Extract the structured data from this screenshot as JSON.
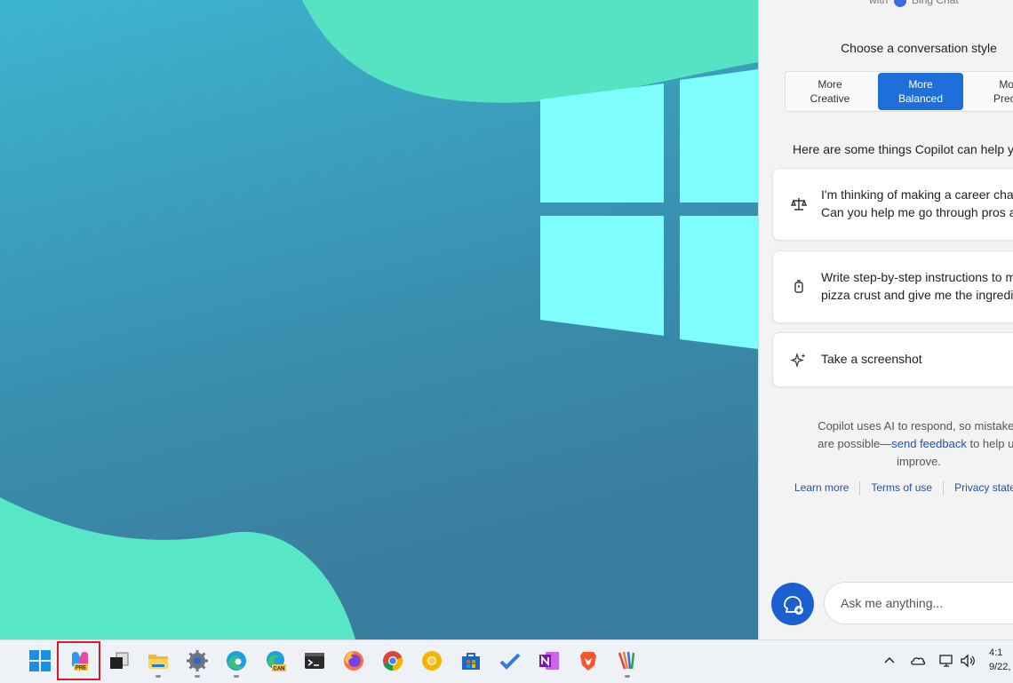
{
  "copilot": {
    "header_partial": "with  Bing Chat",
    "choose_style": "Choose a conversation style",
    "styles": [
      {
        "label": "More\nCreative",
        "active": false
      },
      {
        "label": "More\nBalanced",
        "active": true
      },
      {
        "label": "More\nPrecise",
        "active": false
      }
    ],
    "help_heading": "Here are some things Copilot can help you",
    "suggestions": [
      {
        "icon": "scales-icon",
        "text": "I'm thinking of making a career change.\nCan you help me go through pros and"
      },
      {
        "icon": "timer-icon",
        "text": "Write step-by-step instructions to make\npizza crust and give me the ingredients"
      },
      {
        "icon": "sparkle-icon",
        "text": "Take a screenshot"
      }
    ],
    "disclaimer_before": "Copilot uses AI to respond, so mistakes\nare possible—",
    "disclaimer_link": "send feedback",
    "disclaimer_after": " to help us\nimprove.",
    "links": [
      "Learn more",
      "Terms of use",
      "Privacy statement"
    ],
    "ask_placeholder": "Ask me anything..."
  },
  "taskbar": {
    "apps": [
      "start",
      "copilot-preview",
      "task-view",
      "file-explorer",
      "settings",
      "edge",
      "edge-canary",
      "terminal",
      "firefox",
      "chrome",
      "chrome-canary",
      "microsoft-store",
      "todo",
      "onenote",
      "brave",
      "paint"
    ],
    "copilot_badge": "PRE",
    "canary_badge": "CAN",
    "clock_time": "4:1",
    "clock_date": "9/22,"
  },
  "colors": {
    "accent": "#1e6fd9",
    "highlight_border": "#d01f2a",
    "link": "#1f4fb4"
  }
}
